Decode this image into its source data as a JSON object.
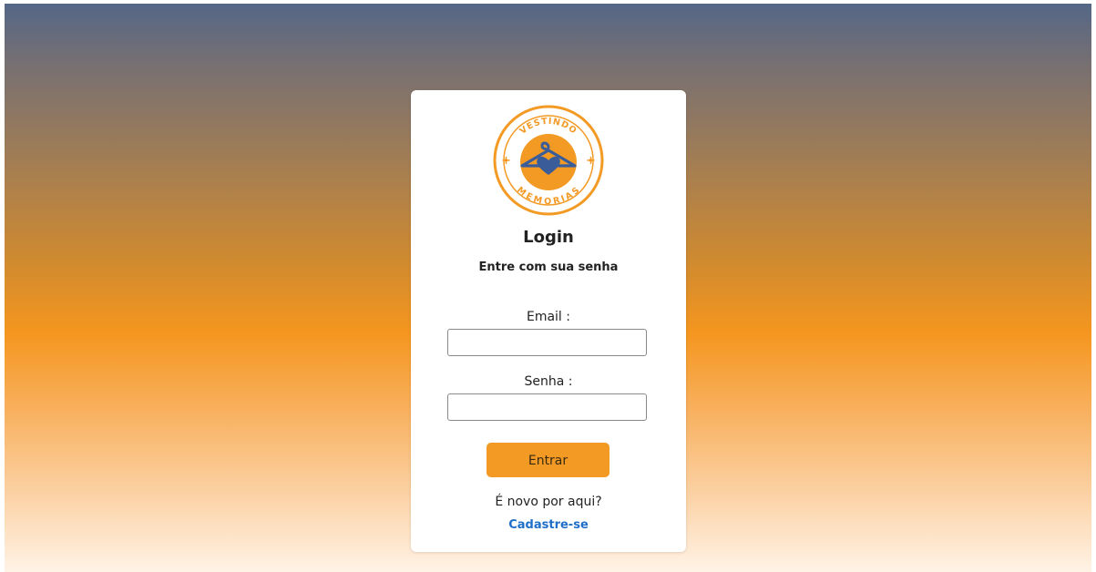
{
  "colors": {
    "accent": "#f39a25",
    "link": "#1f6fc9",
    "logo_blue": "#3a5d9a",
    "logo_orange": "#f39a25"
  },
  "logo": {
    "top_text": "VESTINDO",
    "bottom_text": "MEMORIAS",
    "icon": "hanger-heart-icon"
  },
  "login": {
    "title": "Login",
    "subtitle": "Entre com sua senha",
    "email_label": "Email :",
    "email_value": "",
    "password_label": "Senha :",
    "password_value": "",
    "submit_label": "Entrar",
    "new_here_text": "É novo por aqui?",
    "signup_link": "Cadastre-se"
  }
}
